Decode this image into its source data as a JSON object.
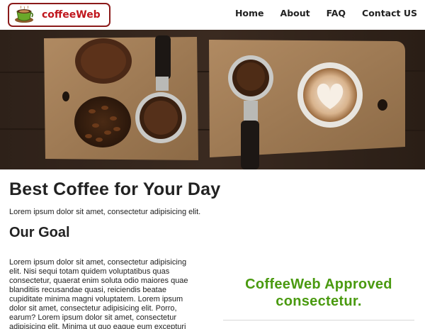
{
  "brand": {
    "name": "coffeeWeb",
    "logo_icon": "coffee-cup-icon",
    "border_color": "#8b1a1a",
    "name_color": "#c0161d"
  },
  "nav": {
    "items": [
      {
        "label": "Home"
      },
      {
        "label": "About"
      },
      {
        "label": "FAQ"
      },
      {
        "label": "Contact US"
      }
    ]
  },
  "hero": {
    "image": "coffee-beans-and-latte-photo"
  },
  "main": {
    "title": "Best Coffee for Your Day",
    "intro": "Lorem ipsum dolor sit amet, consectetur adipisicing elit.",
    "goal_heading": "Our Goal",
    "goal_text": "Lorem ipsum dolor sit amet, consectetur adipisicing elit. Nisi sequi totam quidem voluptatibus quas consectetur, quaerat enim soluta odio maiores quae blanditiis recusandae quasi, reiciendis beatae cupiditate minima magni voluptatem. Lorem ipsum dolor sit amet, consectetur adipisicing elit. Porro, earum? Lorem ipsum dolor sit amet, consectetur adipisicing elit. Minima ut quo eaque eum excepturi"
  },
  "approved": {
    "text": "CoffeeWeb Approved consectetur.",
    "color": "#4a9a10"
  }
}
